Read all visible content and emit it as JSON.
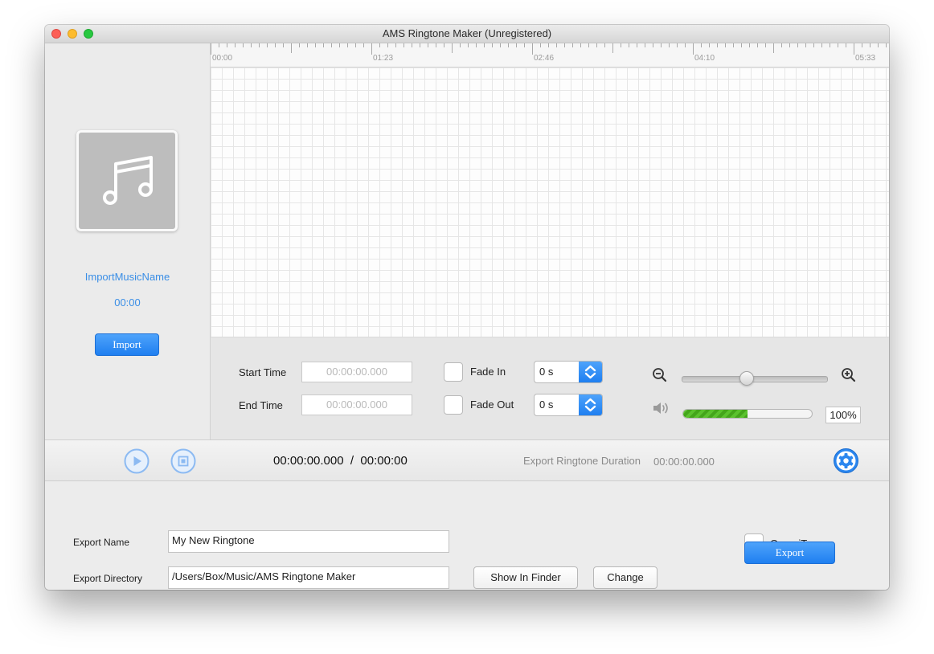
{
  "window": {
    "title": "AMS Ringtone Maker (Unregistered)"
  },
  "left_panel": {
    "music_name": "ImportMusicName",
    "music_duration": "00:00",
    "import_label": "Import"
  },
  "ruler": {
    "labels": [
      "00:00",
      "01:23",
      "02:46",
      "04:10",
      "05:33"
    ]
  },
  "controls": {
    "start_time_label": "Start Time",
    "start_time_placeholder": "00:00:00.000",
    "end_time_label": "End Time",
    "end_time_placeholder": "00:00:00.000",
    "fade_in_label": "Fade In",
    "fade_in_value": "0 s",
    "fade_out_label": "Fade Out",
    "fade_out_value": "0 s",
    "zoom_level": 0.45,
    "volume_fraction": 0.5,
    "volume_percent": "100%"
  },
  "transport": {
    "timecode": "00:00:00.000  /  00:00:00",
    "export_duration_label": "Export Ringtone Duration",
    "export_duration_value": "00:00:00.000"
  },
  "export": {
    "name_label": "Export Name",
    "name_value": "My New Ringtone",
    "directory_label": "Export Directory",
    "directory_value": "/Users/Box/Music/AMS Ringtone Maker",
    "show_in_finder_label": "Show In Finder",
    "change_label": "Change",
    "open_itunes_label": "Open iTunes",
    "export_label": "Export"
  },
  "colors": {
    "accent": "#1f7ff0",
    "link": "#3a8ee6",
    "volume": "#4fb424"
  },
  "icons": [
    "music-note-icon",
    "zoom-out-icon",
    "zoom-in-icon",
    "speaker-icon",
    "play-icon",
    "stop-icon",
    "settings-icon",
    "stepper-arrows-icon"
  ]
}
